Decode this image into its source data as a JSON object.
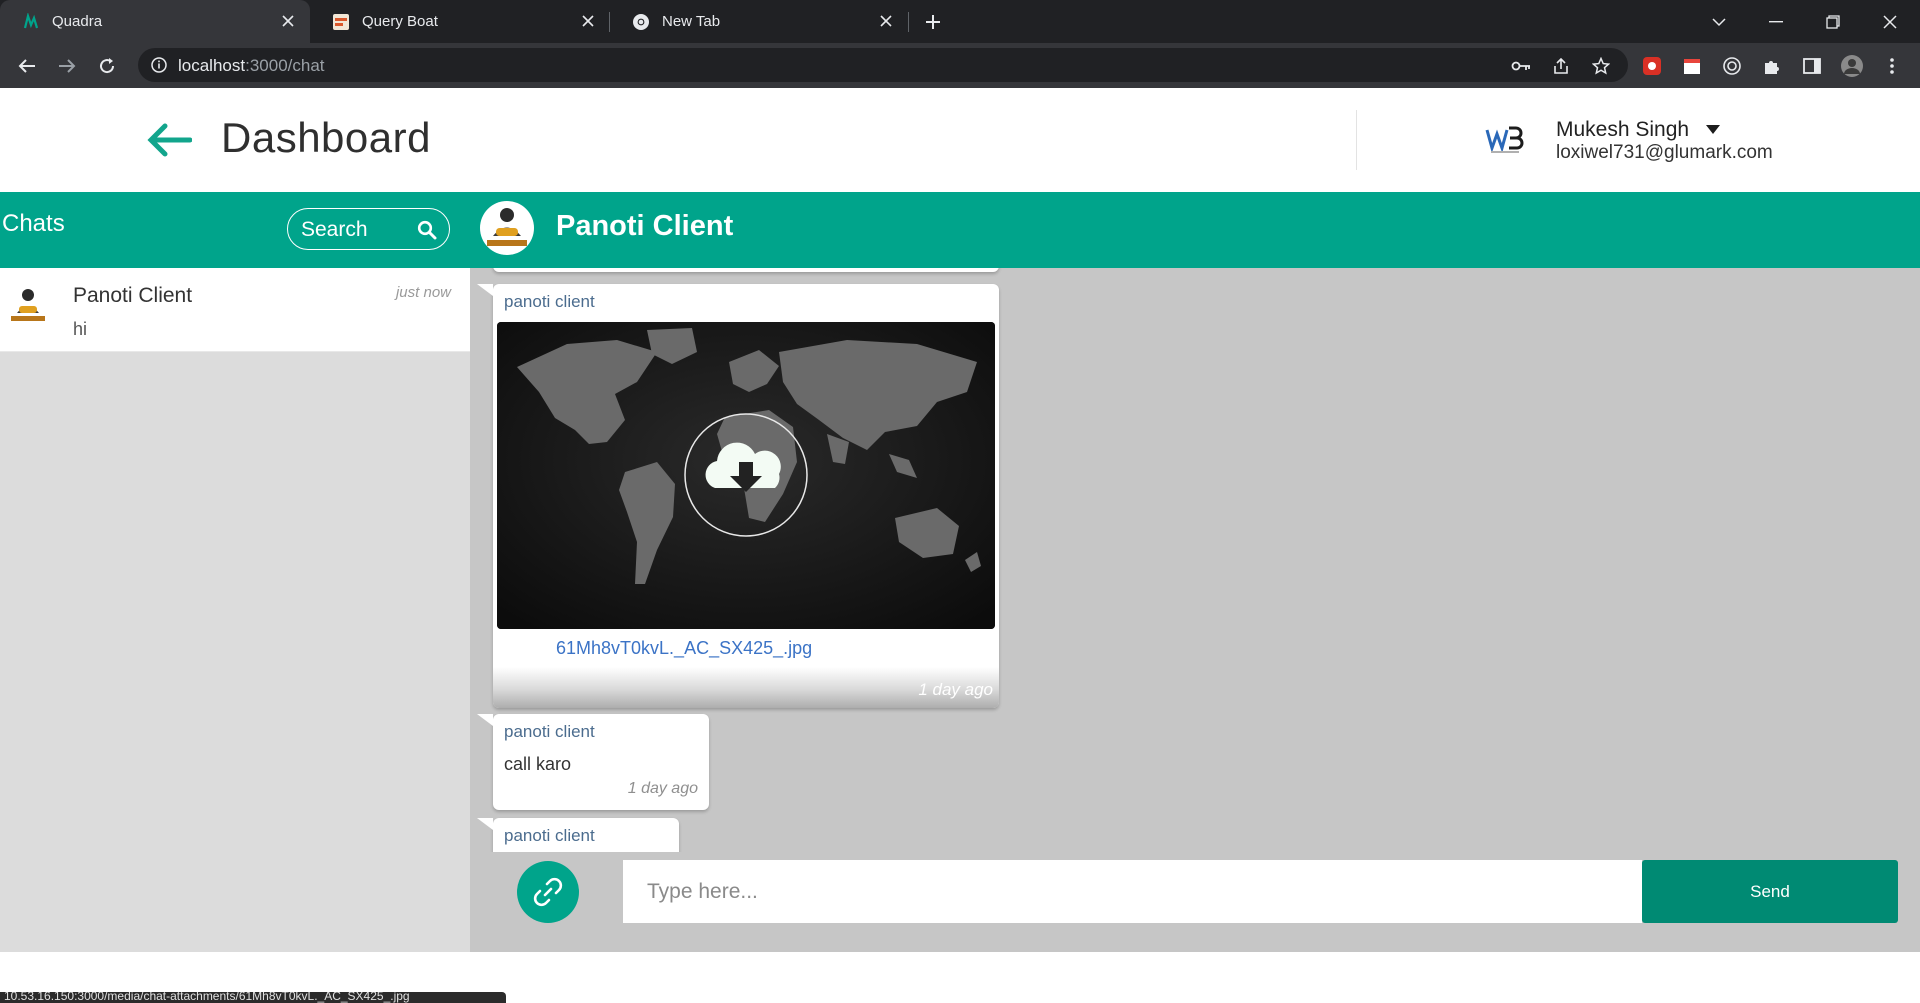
{
  "browser": {
    "tabs": [
      {
        "title": "Quadra",
        "active": true
      },
      {
        "title": "Query Boat",
        "active": false
      },
      {
        "title": "New Tab",
        "active": false
      }
    ],
    "address": {
      "host": "localhost",
      "path": ":3000/chat"
    }
  },
  "header": {
    "title": "Dashboard",
    "user": {
      "name": "Mukesh Singh",
      "email": "loxiwel731@glumark.com"
    }
  },
  "sidebar": {
    "title": "Chats",
    "search_placeholder": "Search",
    "chats": [
      {
        "name": "Panoti Client",
        "time": "just now",
        "last_message": "hi"
      }
    ]
  },
  "chat": {
    "title": "Panoti Client",
    "messages": [
      {
        "sender": "panoti client",
        "type": "image",
        "file_name": "61Mh8vT0kvL._AC_SX425_.jpg",
        "time": "1 day ago"
      },
      {
        "sender": "panoti client",
        "type": "text",
        "text": "call karo",
        "time": "1 day ago"
      },
      {
        "sender": "panoti client",
        "type": "text",
        "text": "",
        "time": ""
      }
    ],
    "input_placeholder": "Type here...",
    "send_label": "Send"
  },
  "status_bar": {
    "text": "10.53.16.150:3000/media/chat-attachments/61Mh8vT0kvL._AC_SX425_.jpg"
  },
  "colors": {
    "accent": "#00a48b",
    "send": "#008a73",
    "chat_bg": "#c6c6c6",
    "sidebar_bg": "#dcdcdc"
  },
  "icons": [
    "back-arrow-icon",
    "search-icon",
    "link-icon",
    "download-cloud-icon",
    "caret-down-icon"
  ]
}
